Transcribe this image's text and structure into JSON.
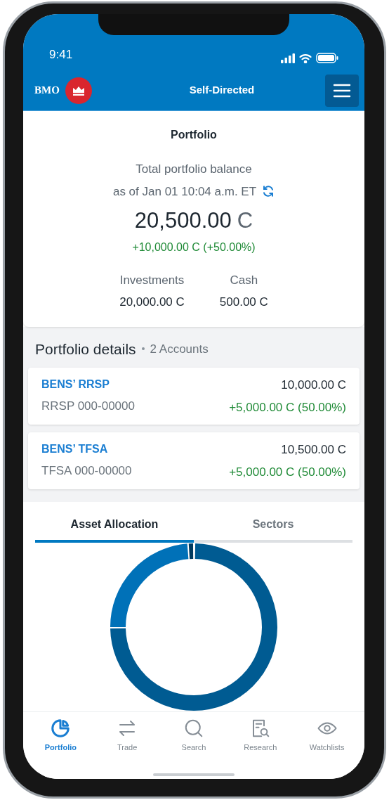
{
  "status_bar": {
    "time": "9:41"
  },
  "app_bar": {
    "logo_text": "BMO",
    "title": "Self-Directed"
  },
  "summary": {
    "title": "Portfolio",
    "balance_label": "Total portfolio balance",
    "as_of": "as of Jan 01 10:04 a.m. ET",
    "balance": "20,500.00",
    "balance_currency": "C",
    "change": "+10,000.00 C (+50.00%)",
    "breakdown": [
      {
        "label": "Investments",
        "value": "20,000.00 C"
      },
      {
        "label": "Cash",
        "value": "500.00 C"
      }
    ]
  },
  "details": {
    "title": "Portfolio details",
    "count": "2 Accounts",
    "accounts": [
      {
        "name": "BENS’ RRSP",
        "number": "RRSP 000-00000",
        "value": "10,000.00 C",
        "change": "+5,000.00 C (50.00%)"
      },
      {
        "name": "BENS’ TFSA",
        "number": "TFSA 000-00000",
        "value": "10,500.00 C",
        "change": "+5,000.00 C (50.00%)"
      }
    ]
  },
  "tabs": [
    {
      "label": "Asset Allocation",
      "selected": true
    },
    {
      "label": "Sectors",
      "selected": false
    }
  ],
  "nav": [
    {
      "label": "Portfolio",
      "kind": "portfolio",
      "selected": true
    },
    {
      "label": "Trade",
      "kind": "trade",
      "selected": false
    },
    {
      "label": "Search",
      "kind": "search",
      "selected": false
    },
    {
      "label": "Research",
      "kind": "research",
      "selected": false
    },
    {
      "label": "Watchlists",
      "kind": "watchlists",
      "selected": false
    }
  ]
}
